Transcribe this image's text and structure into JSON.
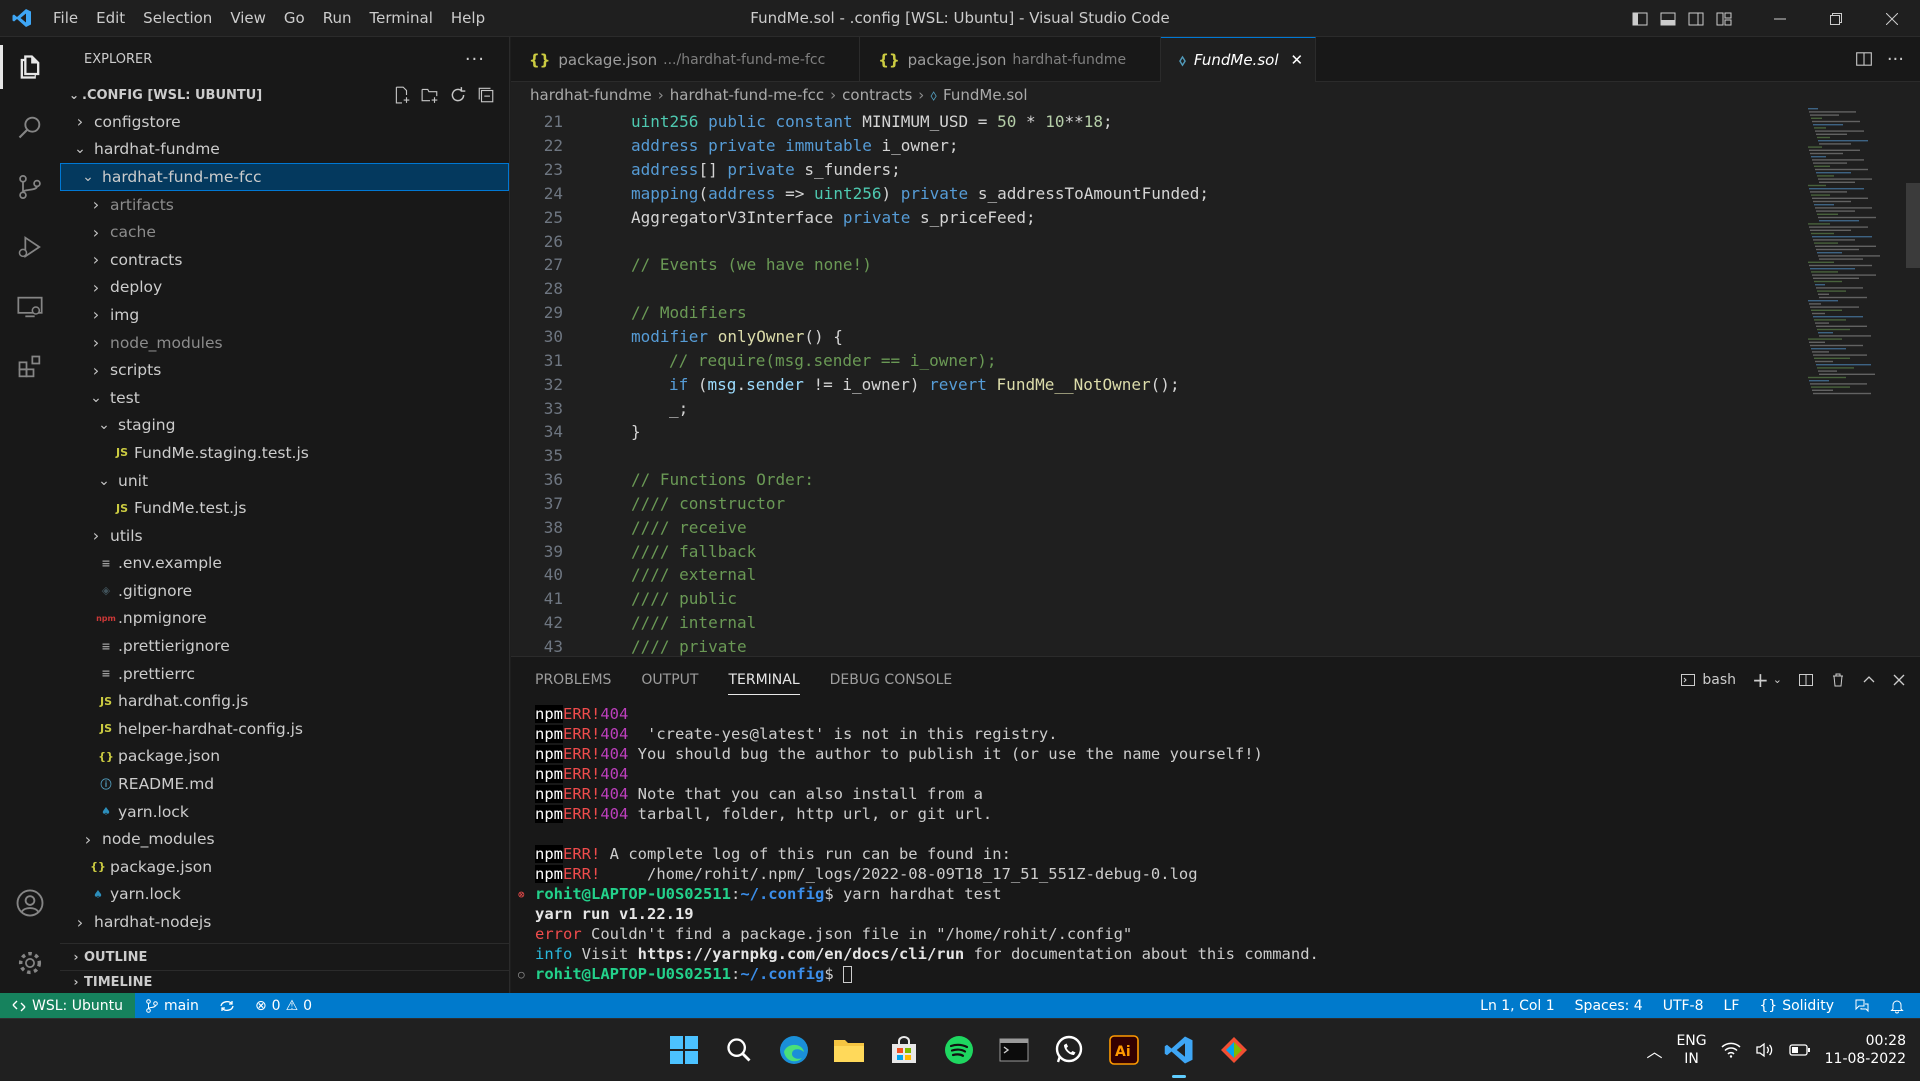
{
  "titlebar": {
    "menu": [
      "File",
      "Edit",
      "Selection",
      "View",
      "Go",
      "Run",
      "Terminal",
      "Help"
    ],
    "title": "FundMe.sol - .config [WSL: Ubuntu] - Visual Studio Code"
  },
  "sidebar": {
    "header": "EXPLORER",
    "section_title": ".CONFIG [WSL: UBUNTU]",
    "tree": [
      {
        "label": "configstore",
        "depth": 0,
        "type": "folder",
        "open": false
      },
      {
        "label": "hardhat-fundme",
        "depth": 0,
        "type": "folder",
        "open": true
      },
      {
        "label": "hardhat-fund-me-fcc",
        "depth": 1,
        "type": "folder",
        "open": true,
        "selected": true
      },
      {
        "label": "artifacts",
        "depth": 2,
        "type": "folder",
        "open": false,
        "dim": true
      },
      {
        "label": "cache",
        "depth": 2,
        "type": "folder",
        "open": false,
        "dim": true
      },
      {
        "label": "contracts",
        "depth": 2,
        "type": "folder",
        "open": false
      },
      {
        "label": "deploy",
        "depth": 2,
        "type": "folder",
        "open": false
      },
      {
        "label": "img",
        "depth": 2,
        "type": "folder",
        "open": false
      },
      {
        "label": "node_modules",
        "depth": 2,
        "type": "folder",
        "open": false,
        "dim": true
      },
      {
        "label": "scripts",
        "depth": 2,
        "type": "folder",
        "open": false
      },
      {
        "label": "test",
        "depth": 2,
        "type": "folder",
        "open": true
      },
      {
        "label": "staging",
        "depth": 3,
        "type": "folder",
        "open": true
      },
      {
        "label": "FundMe.staging.test.js",
        "depth": 4,
        "type": "js"
      },
      {
        "label": "unit",
        "depth": 3,
        "type": "folder",
        "open": true
      },
      {
        "label": "FundMe.test.js",
        "depth": 4,
        "type": "js"
      },
      {
        "label": "utils",
        "depth": 2,
        "type": "folder",
        "open": false
      },
      {
        "label": ".env.example",
        "depth": 2,
        "type": "env"
      },
      {
        "label": ".gitignore",
        "depth": 2,
        "type": "git"
      },
      {
        "label": ".npmignore",
        "depth": 2,
        "type": "npm"
      },
      {
        "label": ".prettierignore",
        "depth": 2,
        "type": "env"
      },
      {
        "label": ".prettierrc",
        "depth": 2,
        "type": "env"
      },
      {
        "label": "hardhat.config.js",
        "depth": 2,
        "type": "js"
      },
      {
        "label": "helper-hardhat-config.js",
        "depth": 2,
        "type": "js"
      },
      {
        "label": "package.json",
        "depth": 2,
        "type": "json"
      },
      {
        "label": "README.md",
        "depth": 2,
        "type": "info"
      },
      {
        "label": "yarn.lock",
        "depth": 2,
        "type": "yarn"
      },
      {
        "label": "node_modules",
        "depth": 1,
        "type": "folder",
        "open": false
      },
      {
        "label": "package.json",
        "depth": 1,
        "type": "json"
      },
      {
        "label": "yarn.lock",
        "depth": 1,
        "type": "yarn"
      },
      {
        "label": "hardhat-nodejs",
        "depth": 0,
        "type": "folder",
        "open": false
      }
    ],
    "outline": "OUTLINE",
    "timeline": "TIMELINE"
  },
  "tabs": [
    {
      "label": "package.json",
      "sub": ".../hardhat-fund-me-fcc",
      "active": false
    },
    {
      "label": "package.json",
      "sub": "hardhat-fundme",
      "active": false
    },
    {
      "label": "FundMe.sol",
      "sub": "",
      "active": true
    }
  ],
  "breadcrumb": [
    "hardhat-fundme",
    "hardhat-fund-me-fcc",
    "contracts",
    "FundMe.sol"
  ],
  "editor": {
    "lines": [
      {
        "n": "21",
        "html": "<span class='ty'>uint256</span> <span class='kw'>public</span> <span class='kw'>constant</span> MINIMUM_USD = <span class='num'>50</span> * <span class='num'>10</span>**<span class='num'>18</span>;",
        "indent": 1
      },
      {
        "n": "22",
        "html": "<span class='kw'>address</span> <span class='kw'>private</span> <span class='kw'>immutable</span> i_owner;",
        "indent": 1
      },
      {
        "n": "23",
        "html": "<span class='kw'>address</span>[] <span class='kw'>private</span> s_funders;",
        "indent": 1
      },
      {
        "n": "24",
        "html": "<span class='kw'>mapping</span>(<span class='kw'>address</span> => <span class='ty'>uint256</span>) <span class='kw'>private</span> s_addressToAmountFunded;",
        "indent": 1
      },
      {
        "n": "25",
        "html": "AggregatorV3Interface <span class='kw'>private</span> s_priceFeed;",
        "indent": 1
      },
      {
        "n": "26",
        "html": "",
        "indent": 1
      },
      {
        "n": "27",
        "html": "<span class='cm'>// Events (we have none!)</span>",
        "indent": 1
      },
      {
        "n": "28",
        "html": "",
        "indent": 1
      },
      {
        "n": "29",
        "html": "<span class='cm'>// Modifiers</span>",
        "indent": 1
      },
      {
        "n": "30",
        "html": "<span class='kw'>modifier</span> <span class='fn'>onlyOwner</span>() {",
        "indent": 1
      },
      {
        "n": "31",
        "html": "<span class='cm'>// require(msg.sender == i_owner);</span>",
        "indent": 2
      },
      {
        "n": "32",
        "html": "<span class='kw'>if</span> (<span class='vr'>msg</span>.<span class='vr'>sender</span> != i_owner) <span class='kw'>revert</span> <span class='fn'>FundMe__NotOwner</span>();",
        "indent": 2
      },
      {
        "n": "33",
        "html": "_;",
        "indent": 2
      },
      {
        "n": "34",
        "html": "}",
        "indent": 1
      },
      {
        "n": "35",
        "html": "",
        "indent": 1
      },
      {
        "n": "36",
        "html": "<span class='cm'>// Functions Order:</span>",
        "indent": 1
      },
      {
        "n": "37",
        "html": "<span class='cm'>//// constructor</span>",
        "indent": 1
      },
      {
        "n": "38",
        "html": "<span class='cm'>//// receive</span>",
        "indent": 1
      },
      {
        "n": "39",
        "html": "<span class='cm'>//// fallback</span>",
        "indent": 1
      },
      {
        "n": "40",
        "html": "<span class='cm'>//// external</span>",
        "indent": 1
      },
      {
        "n": "41",
        "html": "<span class='cm'>//// public</span>",
        "indent": 1
      },
      {
        "n": "42",
        "html": "<span class='cm'>//// internal</span>",
        "indent": 1
      },
      {
        "n": "43",
        "html": "<span class='cm'>//// private</span>",
        "indent": 1
      }
    ]
  },
  "panel": {
    "tabs": [
      "PROBLEMS",
      "OUTPUT",
      "TERMINAL",
      "DEBUG CONSOLE"
    ],
    "active_tab": "TERMINAL",
    "shell": "bash",
    "terminal": [
      {
        "html": "<span class='npm'>npm</span> <span class='err'>ERR!</span> <span class='n404'>404</span>"
      },
      {
        "html": "<span class='npm'>npm</span> <span class='err'>ERR!</span> <span class='n404'>404</span>  'create-yes@latest' is not in this registry."
      },
      {
        "html": "<span class='npm'>npm</span> <span class='err'>ERR!</span> <span class='n404'>404</span> You should bug the author to publish it (or use the name yourself!)"
      },
      {
        "html": "<span class='npm'>npm</span> <span class='err'>ERR!</span> <span class='n404'>404</span>"
      },
      {
        "html": "<span class='npm'>npm</span> <span class='err'>ERR!</span> <span class='n404'>404</span> Note that you can also install from a"
      },
      {
        "html": "<span class='npm'>npm</span> <span class='err'>ERR!</span> <span class='n404'>404</span> tarball, folder, http url, or git url."
      },
      {
        "html": ""
      },
      {
        "html": "<span class='npm'>npm</span> <span class='err'>ERR!</span> A complete log of this run can be found in:"
      },
      {
        "html": "<span class='npm'>npm</span> <span class='err'>ERR!</span>     /home/rohit/.npm/_logs/2022-08-09T18_17_51_551Z-debug-0.log"
      },
      {
        "html": "<span class='dot red'>⊗</span><span class='pg'>rohit@LAPTOP-U0S02511</span>:<span class='pb'>~/.config</span>$ yarn hardhat test"
      },
      {
        "html": "<span class='bold'>yarn run v1.22.19</span>"
      },
      {
        "html": "<span class='red'>error</span> Couldn't find a package.json file in \"/home/rohit/.config\""
      },
      {
        "html": "<span class='cyan'>info</span> Visit <span class='bold'>https://yarnpkg.com/en/docs/cli/run</span> for documentation about this command."
      },
      {
        "html": "<span class='dot' style='color:#8c8c8c'>○</span><span class='pg'>rohit@LAPTOP-U0S02511</span>:<span class='pb'>~/.config</span>$ <span style='border:1px solid #ccc;display:inline-block;width:9px;height:17px'></span>"
      }
    ]
  },
  "status": {
    "remote": "WSL: Ubuntu",
    "branch": "main",
    "errors": "0",
    "warnings": "0",
    "position": "Ln 1, Col 1",
    "spaces": "Spaces: 4",
    "encoding": "UTF-8",
    "eol": "LF",
    "language": "Solidity"
  },
  "taskbar": {
    "lang1": "ENG",
    "lang2": "IN",
    "time": "00:28",
    "date": "11-08-2022"
  }
}
